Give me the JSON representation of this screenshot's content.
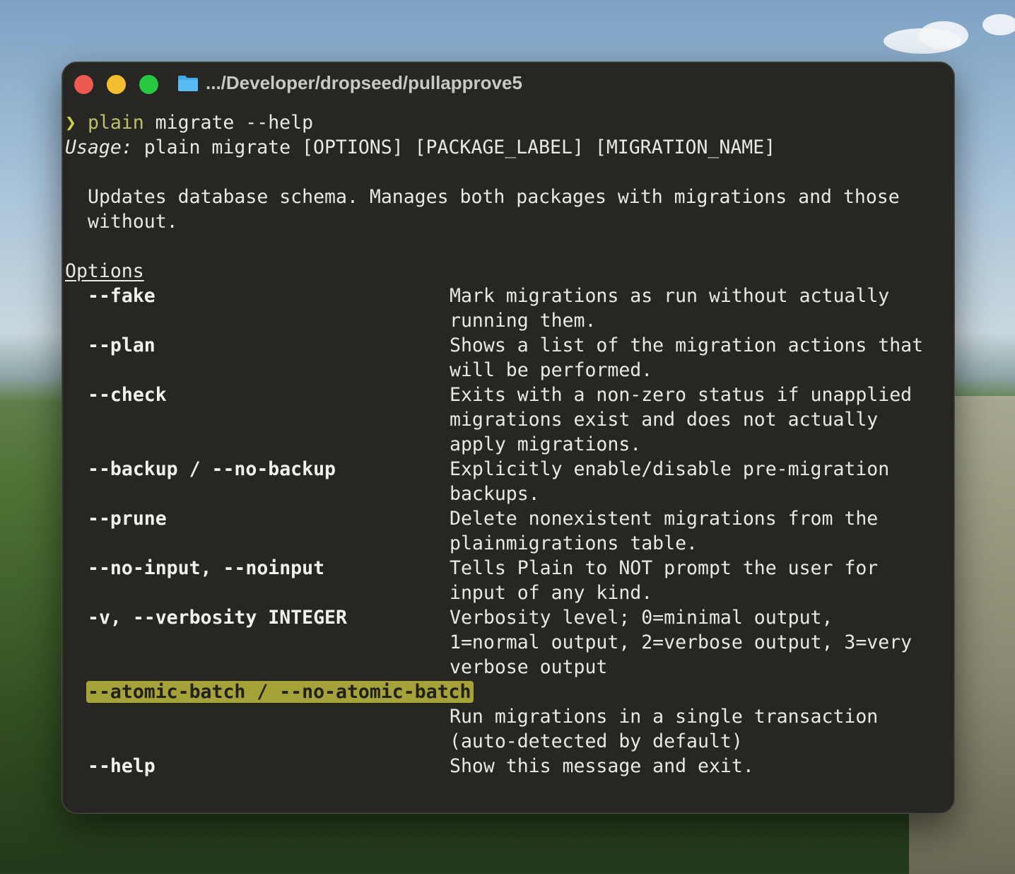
{
  "window": {
    "title": ".../Developer/dropseed/pullapprove5",
    "folder_icon": "folder-icon"
  },
  "terminal": {
    "prompt_symbol": "❯",
    "command_name": "plain",
    "command_args": " migrate --help",
    "usage_label": "Usage:",
    "usage_text": " plain migrate [OPTIONS] [PACKAGE_LABEL] [MIGRATION_NAME]",
    "description_line1": "Updates database schema. Manages both packages with migrations and those",
    "description_line2": "without.",
    "options_heading": "Options",
    "options": [
      {
        "flag": "--fake",
        "desc": [
          "Mark migrations as run without actually",
          "running them."
        ]
      },
      {
        "flag": "--plan",
        "desc": [
          "Shows a list of the migration actions that",
          "will be performed."
        ]
      },
      {
        "flag": "--check",
        "desc": [
          "Exits with a non-zero status if unapplied",
          "migrations exist and does not actually",
          "apply migrations."
        ]
      },
      {
        "flag": "--backup / --no-backup",
        "desc": [
          "Explicitly enable/disable pre-migration",
          "backups."
        ]
      },
      {
        "flag": "--prune",
        "desc": [
          "Delete nonexistent migrations from the",
          "plainmigrations table."
        ]
      },
      {
        "flag": "--no-input, --noinput",
        "desc": [
          "Tells Plain to NOT prompt the user for",
          "input of any kind."
        ]
      },
      {
        "flag": "-v, --verbosity INTEGER",
        "desc": [
          "Verbosity level; 0=minimal output,",
          "1=normal output, 2=verbose output, 3=very",
          "verbose output"
        ]
      },
      {
        "flag": "--atomic-batch / --no-atomic-batch",
        "desc": [
          "",
          "Run migrations in a single transaction",
          "(auto-detected by default)"
        ]
      },
      {
        "flag": "--help",
        "desc": [
          "Show this message and exit."
        ]
      }
    ]
  },
  "colors": {
    "terminal_bg": "#272622",
    "prompt": "#c8d24a",
    "highlight": "#a6a23a",
    "close": "#ee5a52",
    "minimize": "#f5be2f",
    "maximize": "#27c840"
  }
}
